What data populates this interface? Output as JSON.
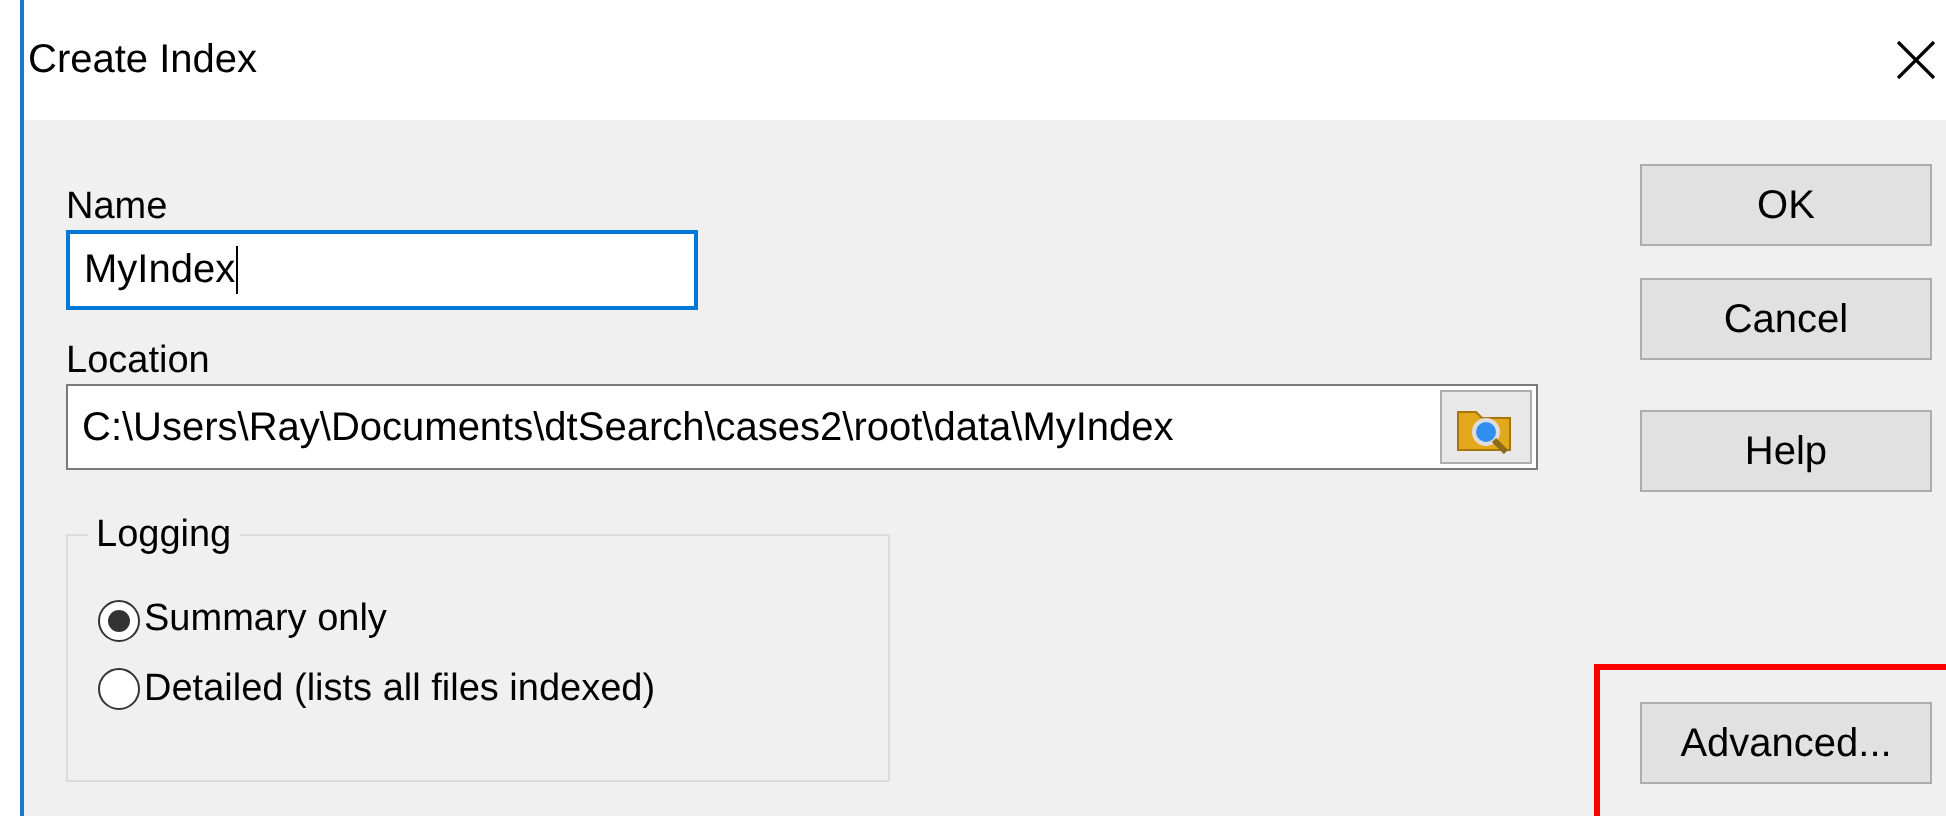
{
  "window": {
    "title": "Create Index"
  },
  "name": {
    "label": "Name",
    "value": "MyIndex"
  },
  "location": {
    "label": "Location",
    "value": "C:\\Users\\Ray\\Documents\\dtSearch\\cases2\\root\\data\\MyIndex"
  },
  "logging": {
    "title": "Logging",
    "options": [
      {
        "label": "Summary only",
        "selected": true
      },
      {
        "label": "Detailed (lists all files indexed)",
        "selected": false
      }
    ]
  },
  "buttons": [
    {
      "label": "OK",
      "highlighted": false
    },
    {
      "label": "Cancel",
      "highlighted": false
    },
    {
      "label": "Help",
      "highlighted": false
    },
    {
      "label": "Advanced...",
      "highlighted": true
    }
  ]
}
